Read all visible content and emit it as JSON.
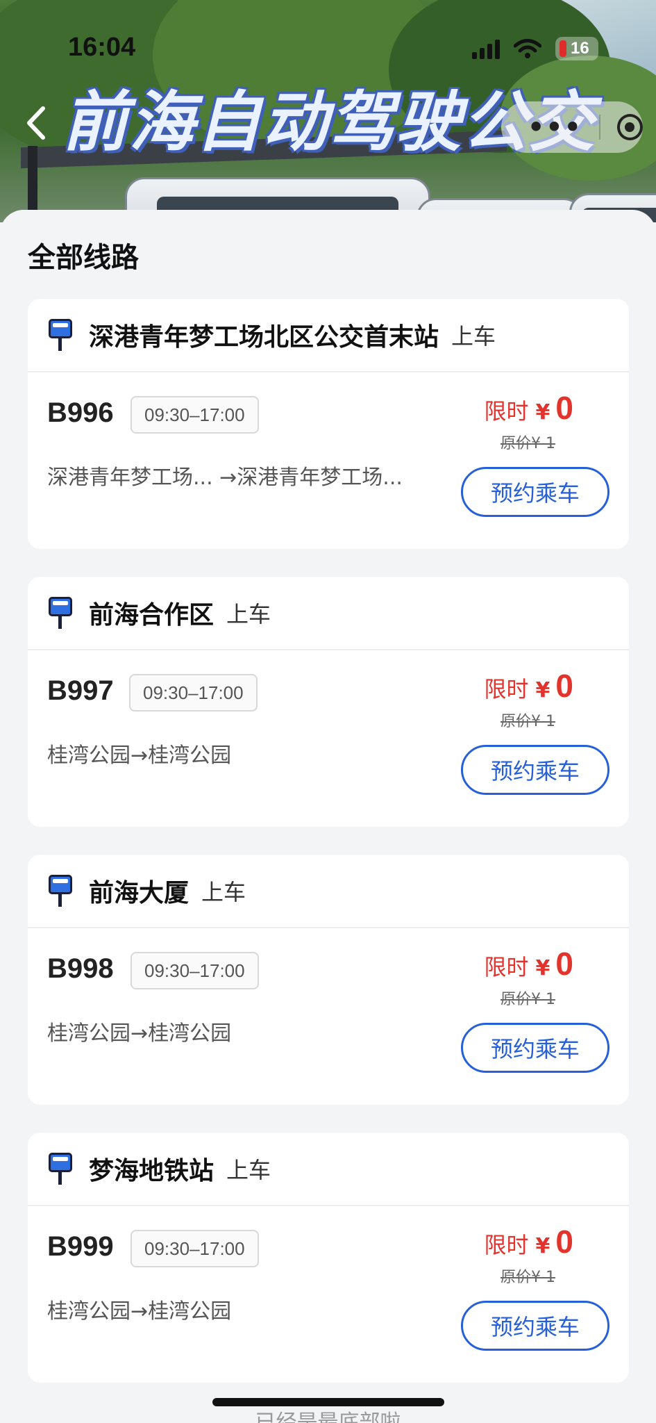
{
  "status_bar": {
    "time": "16:04",
    "battery": "16"
  },
  "header": {
    "title": "前海自动驾驶公交",
    "menu_dots": "•••"
  },
  "section_title": "全部线路",
  "board_label": "上车",
  "book_label": "预约乘车",
  "price": {
    "limited_label": "限时",
    "currency": "¥",
    "value": "0",
    "original": "原价¥ 1"
  },
  "routes": [
    {
      "stop": "深港青年梦工场北区公交首末站",
      "route": "B996",
      "hours": "09:30–17:00",
      "path": "深港青年梦工场... →深港青年梦工场..."
    },
    {
      "stop": "前海合作区",
      "route": "B997",
      "hours": "09:30–17:00",
      "path": "桂湾公园→桂湾公园"
    },
    {
      "stop": "前海大厦",
      "route": "B998",
      "hours": "09:30–17:00",
      "path": "桂湾公园→桂湾公园"
    },
    {
      "stop": "梦海地铁站",
      "route": "B999",
      "hours": "09:30–17:00",
      "path": "桂湾公园→桂湾公园"
    }
  ],
  "footer": "已经是最底部啦",
  "colors": {
    "accent_blue": "#2560d8",
    "price_red": "#e3332d",
    "page_bg": "#f3f4f6"
  },
  "icons": [
    "back-arrow-icon",
    "bus-stop-icon",
    "more-dots-icon",
    "target-icon",
    "signal-icon",
    "wifi-icon",
    "battery-icon"
  ]
}
